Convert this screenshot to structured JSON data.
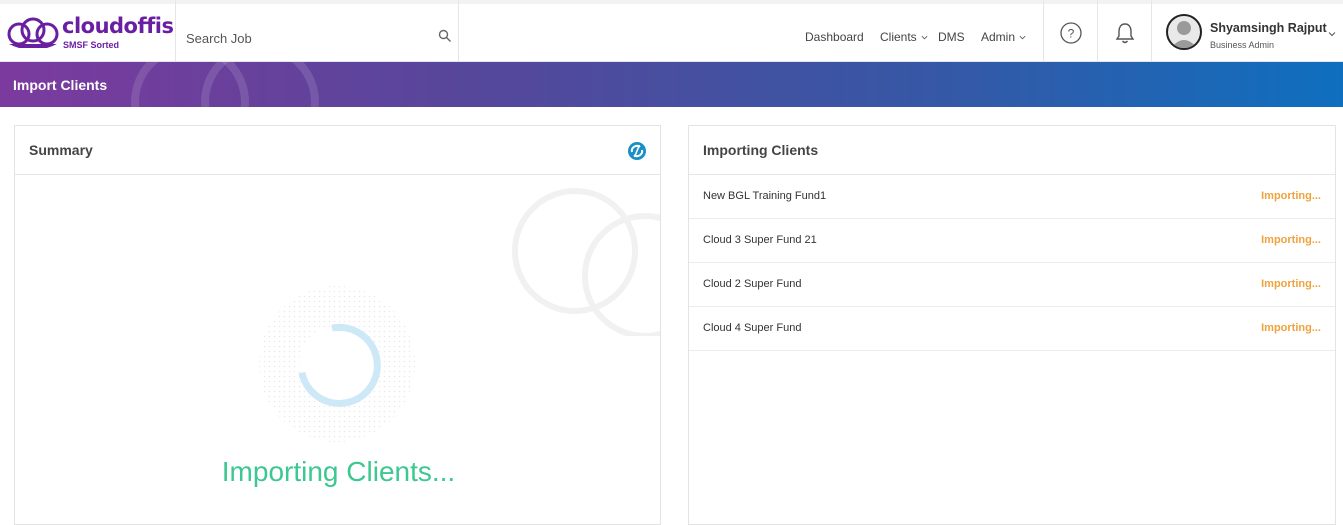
{
  "brand": {
    "name": "cloudoffis",
    "tagline": "SMSF Sorted",
    "color": "#6a1fa3"
  },
  "search": {
    "placeholder": "Search Job"
  },
  "nav": {
    "dashboard": "Dashboard",
    "clients": "Clients",
    "dms": "DMS",
    "admin": "Admin"
  },
  "icons": {
    "search": "search-icon",
    "help": "help-icon",
    "bell": "bell-icon",
    "sync": "sync-icon"
  },
  "user": {
    "name": "Shyamsingh Rajput",
    "role": "Business Admin"
  },
  "page": {
    "title": "Import Clients"
  },
  "summary": {
    "title": "Summary",
    "loading_text": "Importing Clients..."
  },
  "importing": {
    "title": "Importing Clients",
    "rows": [
      {
        "name": "New BGL Training Fund1",
        "status": "Importing..."
      },
      {
        "name": "Cloud 3 Super Fund 21",
        "status": "Importing..."
      },
      {
        "name": "Cloud 2 Super Fund",
        "status": "Importing..."
      },
      {
        "name": "Cloud 4 Super Fund",
        "status": "Importing..."
      }
    ]
  },
  "colors": {
    "status": "#f0a23c",
    "loading": "#3cc88f",
    "spinner": "#cde8f7",
    "sync": "#1a8fc6"
  }
}
